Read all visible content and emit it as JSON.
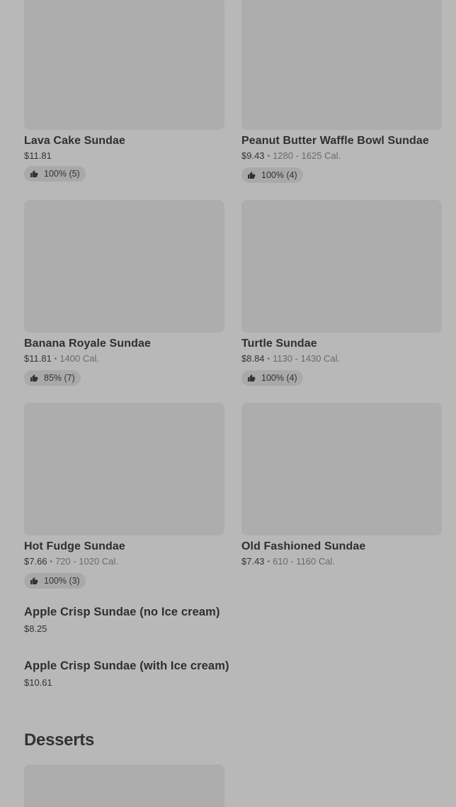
{
  "items": [
    {
      "name": "Lava Cake Sundae",
      "price": "$11.81",
      "calories": "",
      "rating": "100% (5)"
    },
    {
      "name": "Peanut Butter Waffle Bowl Sundae",
      "price": "$9.43",
      "calories": "1280 - 1625 Cal.",
      "rating": "100% (4)"
    },
    {
      "name": "Banana Royale Sundae",
      "price": "$11.81",
      "calories": "1400 Cal.",
      "rating": "85% (7)"
    },
    {
      "name": "Turtle Sundae",
      "price": "$8.84",
      "calories": "1130 - 1430 Cal.",
      "rating": "100% (4)"
    },
    {
      "name": "Hot Fudge Sundae",
      "price": "$7.66",
      "calories": "720 - 1020 Cal.",
      "rating": "100% (3)"
    },
    {
      "name": "Old Fashioned Sundae",
      "price": "$7.43",
      "calories": "610 - 1160 Cal.",
      "rating": ""
    },
    {
      "name": "Apple Crisp Sundae (no Ice cream)",
      "price": "$8.25"
    },
    {
      "name": "Apple Crisp Sundae (with Ice cream)",
      "price": "$10.61"
    }
  ],
  "sections": {
    "desserts_title": "Desserts"
  },
  "icons": {
    "rating": "thumbs-up-icon"
  },
  "colors": {
    "background": "#b8b8b8",
    "placeholder": "#adadad",
    "badge": "#a9a9a9"
  }
}
